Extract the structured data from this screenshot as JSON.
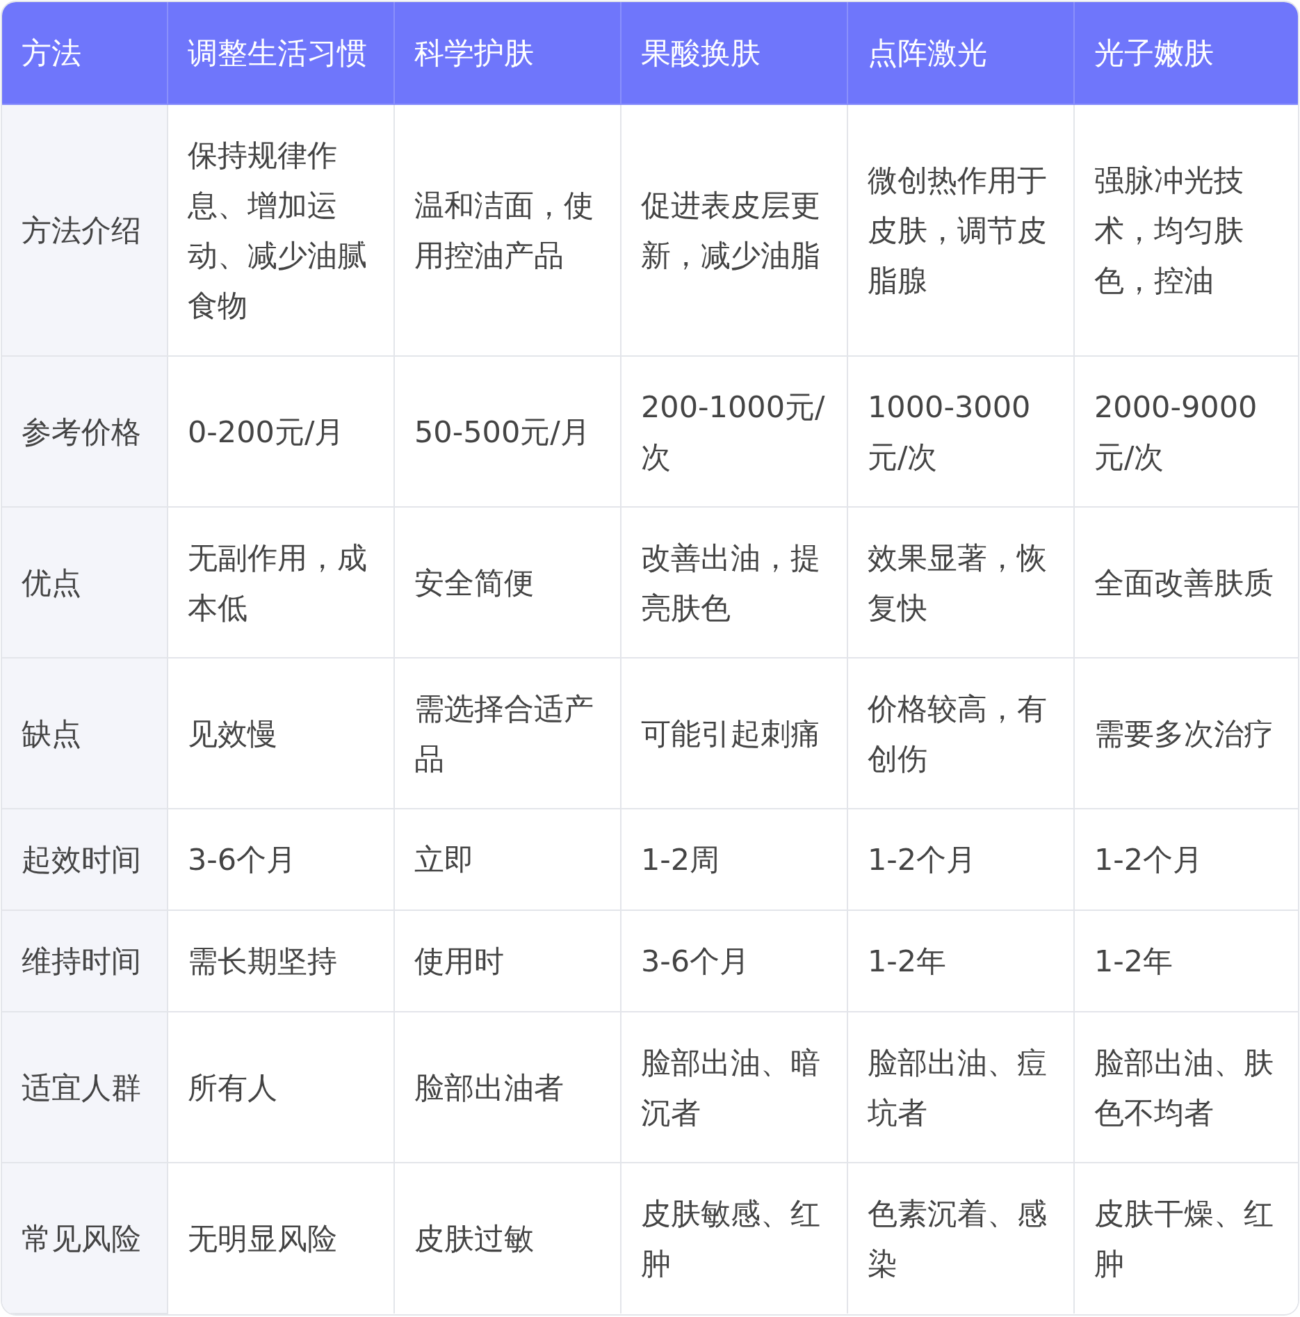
{
  "table": {
    "columns": [
      "方法",
      "调整生活习惯",
      "科学护肤",
      "果酸换肤",
      "点阵激光",
      "光子嫩肤"
    ],
    "rows": [
      [
        "方法介绍",
        "保持规律作息、增加运动、减少油腻食物",
        "温和洁面，使用控油产品",
        "促进表皮层更新，减少油脂",
        "微创热作用于皮肤，调节皮脂腺",
        "强脉冲光技术，均匀肤色，控油"
      ],
      [
        "参考价格",
        "0-200元/月",
        "50-500元/月",
        "200-1000元/次",
        "1000-3000元/次",
        "2000-9000元/次"
      ],
      [
        "优点",
        "无副作用，成本低",
        "安全简便",
        "改善出油，提亮肤色",
        "效果显著，恢复快",
        "全面改善肤质"
      ],
      [
        "缺点",
        "见效慢",
        "需选择合适产品",
        "可能引起刺痛",
        "价格较高，有创伤",
        "需要多次治疗"
      ],
      [
        "起效时间",
        "3-6个月",
        "立即",
        "1-2周",
        "1-2个月",
        "1-2个月"
      ],
      [
        "维持时间",
        "需长期坚持",
        "使用时",
        "3-6个月",
        "1-2年",
        "1-2年"
      ],
      [
        "适宜人群",
        "所有人",
        "脸部出油者",
        "脸部出油、暗沉者",
        "脸部出油、痘坑者",
        "脸部出油、肤色不均者"
      ],
      [
        "常见风险",
        "无明显风险",
        "皮肤过敏",
        "皮肤敏感、红肿",
        "色素沉着、感染",
        "皮肤干燥、红肿"
      ]
    ]
  }
}
